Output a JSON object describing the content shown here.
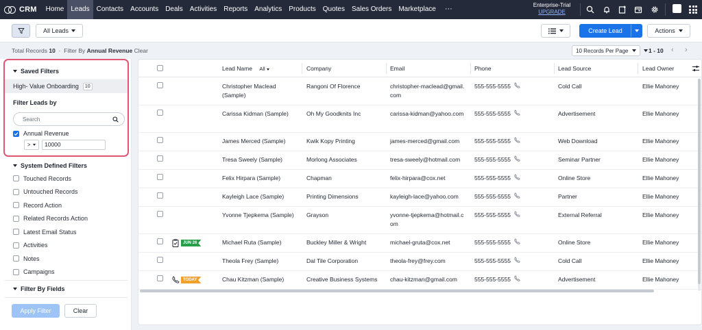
{
  "nav": {
    "brand": "CRM",
    "items": [
      "Home",
      "Leads",
      "Contacts",
      "Accounts",
      "Deals",
      "Activities",
      "Reports",
      "Analytics",
      "Products",
      "Quotes",
      "Sales Orders",
      "Marketplace"
    ],
    "more": "···",
    "trial_label": "Enterprise-Trial",
    "upgrade_label": "UPGRADE"
  },
  "toolbar": {
    "view_selector": "All Leads",
    "create_label": "Create Lead",
    "actions_label": "Actions"
  },
  "records": {
    "total_label": "Total Records",
    "total": "10",
    "filter_by_label": "Filter By",
    "filter_field": "Annual Revenue",
    "clear_label": "Clear",
    "per_page": "10 Records Per Page",
    "range": "1 - 10"
  },
  "sidebar": {
    "saved_filters_title": "Saved Filters",
    "saved_item": "High- Value Onboarding",
    "saved_item_count": "10",
    "filter_leads_by": "Filter Leads by",
    "search_placeholder": "Search",
    "annual_revenue_label": "Annual Revenue",
    "operator": ">",
    "revenue_value": "10000",
    "system_filters_title": "System Defined Filters",
    "system_filters": [
      "Touched Records",
      "Untouched Records",
      "Record Action",
      "Related Records Action",
      "Latest Email Status",
      "Activities",
      "Notes",
      "Campaigns"
    ],
    "filter_by_fields": "Filter By Fields",
    "apply_label": "Apply Filter",
    "clear_label": "Clear"
  },
  "table": {
    "columns": [
      "Lead Name",
      "Company",
      "Email",
      "Phone",
      "Lead Source",
      "Lead Owner"
    ],
    "name_filter": "All",
    "rows": [
      {
        "name": "Christopher Maclead (Sample)",
        "company": "Rangoni Of Florence",
        "email": "christopher-maclead@gmail.com",
        "phone": "555-555-5555",
        "source": "Cold Call",
        "owner": "Ellie Mahoney",
        "tag": ""
      },
      {
        "name": "Carissa Kidman (Sample)",
        "company": "Oh My Goodknits Inc",
        "email": "carissa-kidman@yahoo.com",
        "phone": "555-555-5555",
        "source": "Advertisement",
        "owner": "Ellie Mahoney",
        "tag": ""
      },
      {
        "name": "James Merced (Sample)",
        "company": "Kwik Kopy Printing",
        "email": "james-merced@gmail.com",
        "phone": "555-555-5555",
        "source": "Web Download",
        "owner": "Ellie Mahoney",
        "tag": ""
      },
      {
        "name": "Tresa Sweely (Sample)",
        "company": "Morlong Associates",
        "email": "tresa-sweely@hotmail.com",
        "phone": "555-555-5555",
        "source": "Seminar Partner",
        "owner": "Ellie Mahoney",
        "tag": ""
      },
      {
        "name": "Felix Hirpara (Sample)",
        "company": "Chapman",
        "email": "felix-hirpara@cox.net",
        "phone": "555-555-5555",
        "source": "Online Store",
        "owner": "Ellie Mahoney",
        "tag": ""
      },
      {
        "name": "Kayleigh Lace (Sample)",
        "company": "Printing Dimensions",
        "email": "kayleigh-lace@yahoo.com",
        "phone": "555-555-5555",
        "source": "Partner",
        "owner": "Ellie Mahoney",
        "tag": ""
      },
      {
        "name": "Yvonne Tjepkema (Sample)",
        "company": "Grayson",
        "email": "yvonne-tjepkema@hotmail.com",
        "phone": "555-555-5555",
        "source": "External Referral",
        "owner": "Ellie Mahoney",
        "tag": ""
      },
      {
        "name": "Michael Ruta (Sample)",
        "company": "Buckley Miller & Wright",
        "email": "michael-gruta@cox.net",
        "phone": "555-555-5555",
        "source": "Online Store",
        "owner": "Ellie Mahoney",
        "tag": "JUN 26"
      },
      {
        "name": "Theola Frey (Sample)",
        "company": "Dal Tile Corporation",
        "email": "theola-frey@frey.com",
        "phone": "555-555-5555",
        "source": "Cold Call",
        "owner": "Ellie Mahoney",
        "tag": ""
      },
      {
        "name": "Chau Kitzman (Sample)",
        "company": "Creative Business Systems",
        "email": "chau-kitzman@gmail.com",
        "phone": "555-555-5555",
        "source": "Advertisement",
        "owner": "Ellie Mahoney",
        "tag": "TODAY"
      }
    ]
  },
  "colors": {
    "nav_bg": "#252a3a",
    "accent": "#1a73e8",
    "highlight_border": "#e05574",
    "tag_green": "#2a9d4b",
    "tag_orange": "#f0a12b"
  }
}
